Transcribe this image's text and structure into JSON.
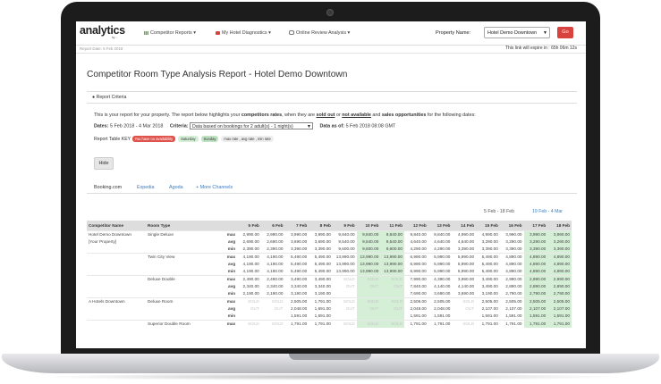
{
  "app": {
    "logo": "analytics",
    "logo_sub": "by ...",
    "nav": [
      {
        "label": "Competitor Reports ▾",
        "icon": "bar-chart-icon",
        "color": "#6aa84f"
      },
      {
        "label": "My Hotel Diagnostics ▾",
        "icon": "video-icon",
        "color": "#d9433d"
      },
      {
        "label": "Online Review Analysis ▾",
        "icon": "comment-icon",
        "color": "#777777"
      }
    ],
    "property_label": "Property Name:",
    "property_value": "Hotel Demo Downtown",
    "go_label": "Go",
    "subbar_left": "Report Date: 5 Feb 2018",
    "expiry": "This link will expire in : 65h 06m 12s"
  },
  "report": {
    "title": "Competitor Room Type Analysis Report - Hotel Demo Downtown",
    "criteria_header": "Report Criteria",
    "info": {
      "a": "This is your report for your property. The report below highlights your ",
      "b": "competitors rates",
      "c": ", when they are ",
      "d": "sold out",
      "e": " or ",
      "f": "not available",
      "g": " and ",
      "h": "sales opportunities",
      "i": " for the following dates:"
    },
    "dates_label": "Dates:",
    "dates_value": "5 Feb 2018 - 4 Mar 2018",
    "criteria_label": "Criteria:",
    "criteria_value": "Data based on bookings for 2 adult(s) - 1 night(s)",
    "data_as_of_label": "Data as of:",
    "data_as_of_value": "5 Feb 2018 08:08 GMT",
    "key_label": "Report Table KEY",
    "key_pills": [
      {
        "label": "You have no availability",
        "bg": "#e0534d",
        "fg": "#ffffff"
      },
      {
        "label": "Saturday",
        "bg": "#d4efd6",
        "fg": "#333333"
      },
      {
        "label": "Sunday",
        "bg": "#bfe3c2",
        "fg": "#333333"
      },
      {
        "label": "max rate , avg rate , min rate",
        "bg": "#eeeeee",
        "fg": "#333333"
      }
    ],
    "hide_label": "Hide",
    "tabs": [
      "Booking.com",
      "Expedia",
      "Agoda",
      "+ More Channels"
    ],
    "range_links": [
      "5 Feb - 18 Feb",
      "19 Feb - 4 Mar"
    ]
  },
  "table": {
    "headers": [
      "Competitor Name",
      "Room Type",
      "",
      "5 Feb",
      "6 Feb",
      "7 Feb",
      "8 Feb",
      "9 Feb",
      "10 Feb",
      "11 Feb",
      "12 Feb",
      "13 Feb",
      "14 Feb",
      "15 Feb",
      "16 Feb",
      "17 Feb",
      "18 Feb"
    ],
    "green_cols": [
      5,
      6,
      12,
      13
    ],
    "rows": [
      {
        "sep": true,
        "comp": "Hotel Demo Downtown",
        "room": "Single Deluxe",
        "metric": "max",
        "vals": [
          "2,990.00",
          "2,990.00",
          "3,990.00",
          "3,990.00",
          "9,840.00",
          "9,840.00",
          "9,840.00",
          "9,840.00",
          "9,840.00",
          "4,990.00",
          "4,990.00",
          "3,990.00",
          "3,990.00",
          "3,990.00"
        ]
      },
      {
        "comp": "[Your Property]",
        "room": "",
        "metric": "avg",
        "vals": [
          "2,690.00",
          "2,690.00",
          "3,690.00",
          "3,690.00",
          "9,540.00",
          "9,540.00",
          "9,540.00",
          "4,640.00",
          "4,640.00",
          "4,640.00",
          "3,290.00",
          "3,290.00",
          "3,290.00",
          "3,290.00"
        ]
      },
      {
        "comp": "",
        "room": "",
        "metric": "min",
        "vals": [
          "2,390.00",
          "2,390.00",
          "3,390.00",
          "3,390.00",
          "9,600.00",
          "9,600.00",
          "9,600.00",
          "4,290.00",
          "4,290.00",
          "3,390.00",
          "3,390.00",
          "3,390.00",
          "3,390.00",
          "3,390.00"
        ]
      },
      {
        "sep": true,
        "comp": "",
        "room": "Twin City View",
        "metric": "max",
        "vals": [
          "4,190.00",
          "4,190.00",
          "5,490.00",
          "5,490.00",
          "13,990.00",
          "13,990.00",
          "13,990.00",
          "6,990.00",
          "5,990.00",
          "5,990.00",
          "5,490.00",
          "4,890.00",
          "4,890.00",
          "4,890.00"
        ]
      },
      {
        "comp": "",
        "room": "",
        "metric": "avg",
        "vals": [
          "4,190.00",
          "4,190.00",
          "5,490.00",
          "5,490.00",
          "13,990.00",
          "13,990.00",
          "13,990.00",
          "6,990.00",
          "5,990.00",
          "5,990.00",
          "5,490.00",
          "4,890.00",
          "4,890.00",
          "4,890.00"
        ]
      },
      {
        "comp": "",
        "room": "",
        "metric": "min",
        "vals": [
          "4,190.00",
          "4,190.00",
          "5,490.00",
          "5,490.00",
          "13,990.00",
          "13,990.00",
          "13,990.00",
          "6,990.00",
          "5,990.00",
          "5,990.00",
          "5,490.00",
          "4,890.00",
          "4,890.00",
          "4,890.00"
        ]
      },
      {
        "sep": true,
        "comp": "",
        "room": "Deluxe Double",
        "metric": "max",
        "vals": [
          "2,490.00",
          "2,490.00",
          "3,490.00",
          "3,490.00",
          "SOLD",
          "SOLD",
          "SOLD",
          "7,990.00",
          "4,390.00",
          "3,990.00",
          "3,490.00",
          "2,990.00",
          "2,990.00",
          "2,990.00"
        ]
      },
      {
        "comp": "",
        "room": "",
        "metric": "avg",
        "vals": [
          "2,340.00",
          "2,340.00",
          "3,340.00",
          "3,340.00",
          "OUT",
          "OUT",
          "OUT",
          "7,840.00",
          "4,140.00",
          "4,140.00",
          "3,490.00",
          "2,890.00",
          "2,890.00",
          "2,890.00"
        ]
      },
      {
        "comp": "",
        "room": "",
        "metric": "min",
        "vals": [
          "2,190.00",
          "2,190.00",
          "3,190.00",
          "3,190.00",
          "",
          "",
          "",
          "7,690.00",
          "3,690.00",
          "3,690.00",
          "3,190.00",
          "2,790.00",
          "2,790.00",
          "2,790.00"
        ]
      },
      {
        "sep": true,
        "comp": "A Hotels Downtown",
        "room": "Deluxe Room",
        "metric": "max",
        "vals": [
          "SOLD",
          "SOLD",
          "2,505.00",
          "1,791.00",
          "SOLD",
          "SOLD",
          "SOLD",
          "2,505.00",
          "2,505.00",
          "SOLD",
          "2,505.00",
          "2,505.00",
          "2,505.00",
          "2,505.00"
        ]
      },
      {
        "comp": "",
        "room": "",
        "metric": "avg",
        "vals": [
          "OUT",
          "OUT",
          "2,048.00",
          "1,691.00",
          "OUT",
          "OUT",
          "OUT",
          "2,048.00",
          "2,048.00",
          "OUT",
          "2,107.00",
          "2,107.00",
          "2,107.00",
          "2,107.00"
        ]
      },
      {
        "comp": "",
        "room": "",
        "metric": "min",
        "vals": [
          "",
          "",
          "1,591.00",
          "1,591.00",
          "",
          "",
          "",
          "1,591.00",
          "1,591.00",
          "",
          "1,591.00",
          "1,591.00",
          "1,591.00",
          "1,591.00"
        ]
      },
      {
        "sep": true,
        "comp": "",
        "room": "Superior Double Room",
        "metric": "max",
        "vals": [
          "SOLD",
          "SOLD",
          "1,791.00",
          "1,791.00",
          "SOLD",
          "SOLD",
          "SOLD",
          "1,791.00",
          "1,791.00",
          "SOLD",
          "1,791.00",
          "1,791.00",
          "1,791.00",
          "1,791.00"
        ]
      }
    ]
  }
}
